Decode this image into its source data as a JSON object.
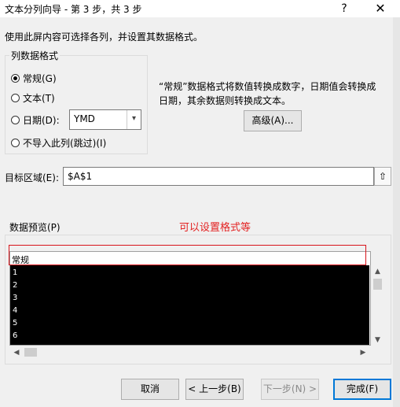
{
  "window": {
    "title": "文本分列向导 - 第 3 步，共 3 步",
    "help": "?",
    "close": "✕"
  },
  "instruction": "使用此屏内容可选择各列，并设置其数据格式。",
  "column_format": {
    "legend": "列数据格式",
    "options": [
      "常规(G)",
      "文本(T)",
      "日期(D):",
      "不导入此列(跳过)(I)"
    ],
    "selected": "常规(G)",
    "date_format_value": "YMD"
  },
  "description": "“常规”数据格式将数值转换成数字，日期值会转换成日期，其余数据则转换成文本。",
  "advanced_button": "高级(A)...",
  "destination": {
    "label": "目标区域(E):",
    "value": "$A$1"
  },
  "preview": {
    "label": "数据预览(P)",
    "annotation": "可以设置格式等",
    "header": "常规",
    "rows": [
      "1",
      "2",
      "3",
      "4",
      "5",
      "6"
    ]
  },
  "buttons": {
    "cancel": "取消",
    "back": "< 上一步(B)",
    "next": "下一步(N) >",
    "finish": "完成(F)"
  },
  "colors": {
    "annotation": "#e32222",
    "primary_border": "#0078d7"
  }
}
